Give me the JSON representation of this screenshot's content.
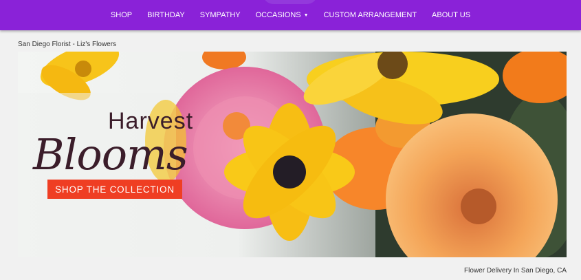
{
  "nav": {
    "items": [
      {
        "label": "SHOP"
      },
      {
        "label": "BIRTHDAY"
      },
      {
        "label": "SYMPATHY"
      },
      {
        "label": "OCCASIONS",
        "has_dropdown": true,
        "caret": "▼"
      },
      {
        "label": "CUSTOM ARRANGEMENT"
      },
      {
        "label": "ABOUT US"
      }
    ]
  },
  "breadcrumb": "San Diego Florist - Liz's Flowers",
  "banner": {
    "title_line1": "Harvest",
    "title_line2": "Blooms",
    "cta_label": "SHOP THE COLLECTION"
  },
  "footer": {
    "text": "Flower Delivery In San Diego, CA"
  },
  "colors": {
    "nav_bg": "#8a22d8",
    "cta_bg": "#ef3e23",
    "page_bg": "#f1f1f1"
  }
}
